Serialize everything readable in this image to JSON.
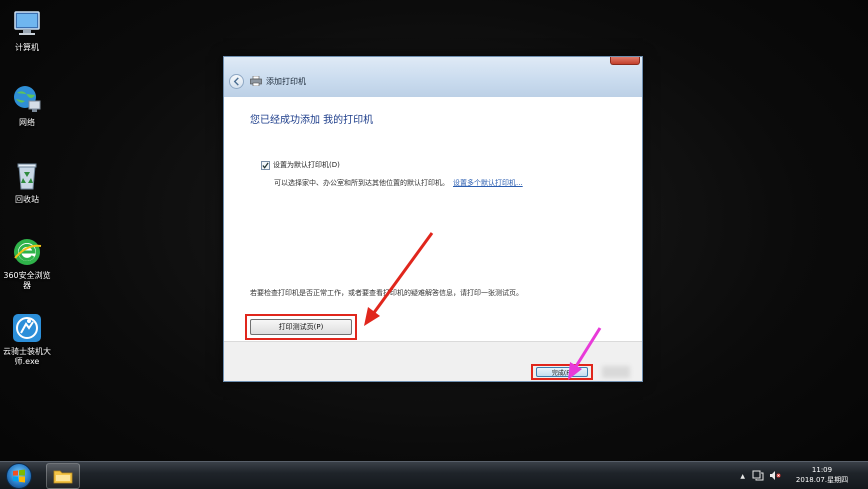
{
  "desktop": {
    "icons": [
      {
        "label": "计算机",
        "icon": "computer-icon"
      },
      {
        "label": "网络",
        "icon": "network-icon"
      },
      {
        "label": "回收站",
        "icon": "recycle-bin-icon"
      },
      {
        "label": "360安全浏览器",
        "icon": "browser-360-icon"
      },
      {
        "label": "云骑士装机大师.exe",
        "icon": "yunqishi-icon"
      }
    ]
  },
  "dialog": {
    "title": "添加打印机",
    "heading": "您已经成功添加 我的打印机",
    "default_checkbox_label": "设置为默认打印机(D)",
    "default_checked": true,
    "description": "可以选择家中、办公室和所到达其他位置的默认打印机。",
    "description_link": "设置多个默认打印机...",
    "test_note": "若要检查打印机是否正常工作，或者要查看打印机的疑难解答信息，请打印一张测试页。",
    "test_button": "打印测试页(P)",
    "finish_button": "完成(F)"
  },
  "taskbar": {
    "time": "11:09",
    "date": "2018.07.星期四",
    "tray_up_arrow": "▲"
  },
  "colors": {
    "highlight": "#e0261c",
    "arrow_red": "#e0261c",
    "arrow_magenta": "#e83ad8",
    "heading_blue": "#1f3f8c"
  }
}
